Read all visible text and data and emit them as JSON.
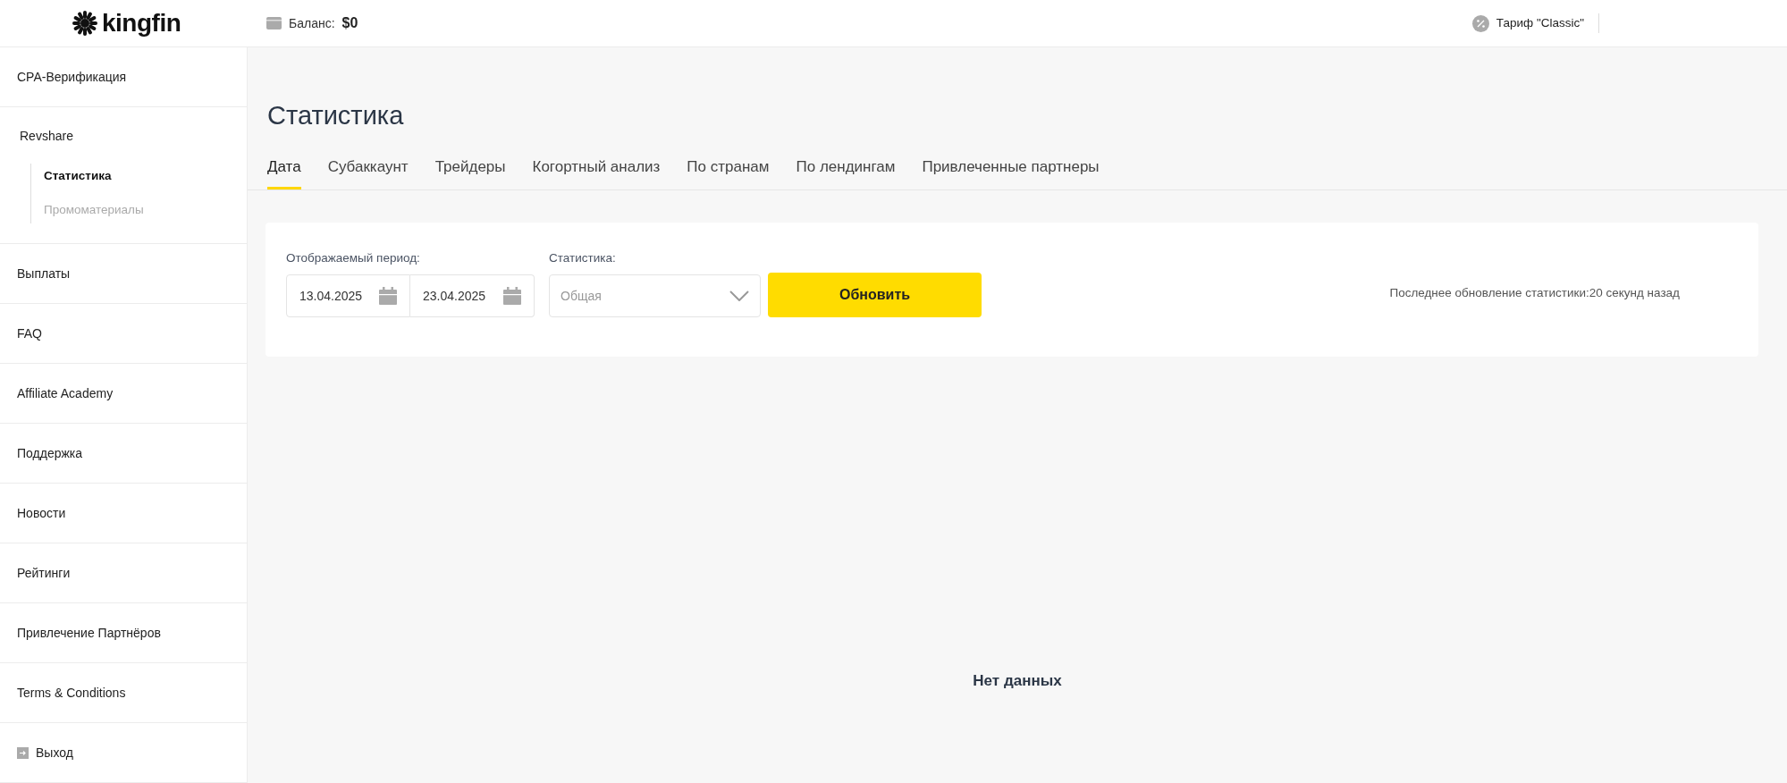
{
  "header": {
    "logo": "kingfin",
    "balance_label": "Баланс:",
    "balance_value": "$0",
    "tariff": "Тариф \"Classic\""
  },
  "sidebar": {
    "items": [
      {
        "kind": "link",
        "label": "CPA-Верификация"
      },
      {
        "kind": "group",
        "label": "Revshare",
        "children": [
          {
            "label": "Статистика",
            "selected": true
          },
          {
            "label": "Промоматериалы",
            "selected": false
          }
        ]
      },
      {
        "kind": "link",
        "label": "Выплаты"
      },
      {
        "kind": "link",
        "label": "FAQ"
      },
      {
        "kind": "link",
        "label": "Affiliate Academy"
      },
      {
        "kind": "link",
        "label": "Поддержка"
      },
      {
        "kind": "link",
        "label": "Новости"
      },
      {
        "kind": "link",
        "label": "Рейтинги"
      },
      {
        "kind": "link",
        "label": "Привлечение Партнёров"
      },
      {
        "kind": "link",
        "label": "Terms & Conditions"
      },
      {
        "kind": "logout",
        "label": "Выход"
      }
    ]
  },
  "page": {
    "title": "Статистика",
    "tabs": [
      {
        "label": "Дата",
        "selected": true
      },
      {
        "label": "Субаккаунт",
        "selected": false
      },
      {
        "label": "Трейдеры",
        "selected": false
      },
      {
        "label": "Когортный анализ",
        "selected": false
      },
      {
        "label": "По странам",
        "selected": false
      },
      {
        "label": "По лендингам",
        "selected": false
      },
      {
        "label": "Привлеченные партнеры",
        "selected": false
      }
    ],
    "filters": {
      "period_label": "Отображаемый период:",
      "date_from": "13.04.2025",
      "date_to": "23.04.2025",
      "stat_label": "Статистика:",
      "stat_placeholder": "Общая",
      "button": "Обновить",
      "last_update": "Последнее обновление статистики:20 секунд назад"
    },
    "empty_message": "Нет данных"
  }
}
